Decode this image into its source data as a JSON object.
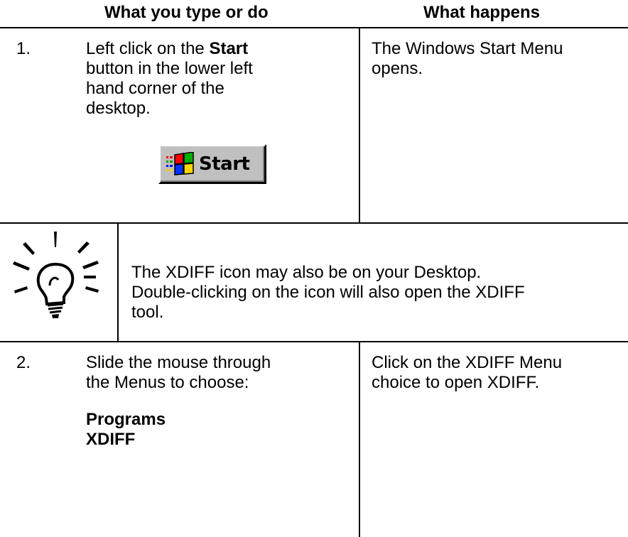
{
  "header": {
    "col1": "What you type or do",
    "col2": "What happens"
  },
  "step1": {
    "number": "1.",
    "text_before": "Left click on the ",
    "text_bold": "Start",
    "text_after_lines": [
      "button in the lower left",
      "hand corner of the",
      "desktop."
    ],
    "button_label": "Start",
    "result_lines": [
      "The Windows Start Menu",
      "opens."
    ]
  },
  "tip": {
    "icon": "lightbulb-icon",
    "lines": [
      "The XDIFF icon may also be on your Desktop.",
      "Double-clicking on the icon will also open the XDIFF",
      "tool."
    ]
  },
  "step2": {
    "number": "2.",
    "lines": [
      "Slide the mouse through",
      "the Menus to choose:"
    ],
    "choices": [
      "Programs",
      "XDIFF"
    ],
    "result_lines": [
      "Click on the XDIFF Menu",
      "choice to open XDIFF."
    ]
  }
}
